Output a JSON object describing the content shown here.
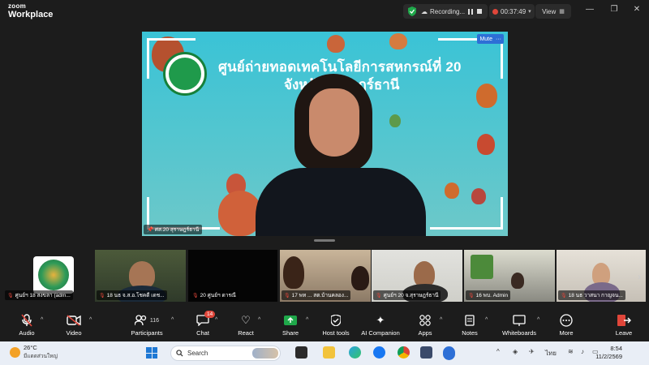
{
  "app": {
    "brand_top": "zoom",
    "brand_bottom": "Workplace",
    "recording_label": "Recording...",
    "timer": "00:37:49",
    "view_label": "View",
    "window_controls": [
      "minimize-icon",
      "restore-icon",
      "close-icon"
    ]
  },
  "main_video": {
    "banner_line1": "ศูนย์ถ่ายทอดเทคโนโลยีการสหกรณ์ที่ 20",
    "banner_line2": "จังหวัดสุราษฎร์ธานี",
    "participant_name": "ศส.20 สุราษฎร์ธานี",
    "mute_label": "Mute",
    "more_icon": "ellipsis-icon"
  },
  "gallery": {
    "tiles": [
      {
        "name": "ศูนย์ฯ 18 สงขลา (adm...",
        "muted": true
      },
      {
        "name": "18 นธ จ.ส.อ.โชคดี เดช...",
        "muted": true
      },
      {
        "name": "20 ศูนย์ฯ ดารณี",
        "muted": true
      },
      {
        "name": "17 พท ... สต.บ้านคลอง...",
        "muted": true
      },
      {
        "name": "ศูนย์ฯ 20 จ.สุราษฎร์ธานี",
        "muted": true
      },
      {
        "name": "16 พบ. Admin",
        "muted": true
      },
      {
        "name": "18 นธ วาสนา กาญจน...",
        "muted": true
      }
    ]
  },
  "toolbar": {
    "items": [
      {
        "label": "Audio",
        "icon": "microphone-muted-icon"
      },
      {
        "label": "Video",
        "icon": "video-off-icon"
      },
      {
        "label": "Participants",
        "icon": "participants-icon",
        "count": "116"
      },
      {
        "label": "Chat",
        "icon": "chat-icon",
        "badge": "14"
      },
      {
        "label": "React",
        "icon": "heart-icon"
      },
      {
        "label": "Share",
        "icon": "share-screen-icon"
      },
      {
        "label": "Host tools",
        "icon": "shield-icon"
      },
      {
        "label": "AI Companion",
        "icon": "sparkle-icon"
      },
      {
        "label": "Apps",
        "icon": "apps-icon"
      },
      {
        "label": "Notes",
        "icon": "notes-icon"
      },
      {
        "label": "Whiteboards",
        "icon": "whiteboard-icon"
      },
      {
        "label": "More",
        "icon": "more-icon"
      },
      {
        "label": "Leave",
        "icon": "leave-icon"
      }
    ]
  },
  "taskbar": {
    "temperature": "26°C",
    "weather_text": "มีแดดส่วนใหญ่",
    "search_placeholder": "Search",
    "language": "ไทย",
    "time": "8:54",
    "date": "11/2/2569"
  },
  "colors": {
    "accent_blue": "#2d6fd6",
    "mute_red": "#e0463a",
    "share_green": "#1fa84a",
    "background": "#1c1c1c"
  }
}
